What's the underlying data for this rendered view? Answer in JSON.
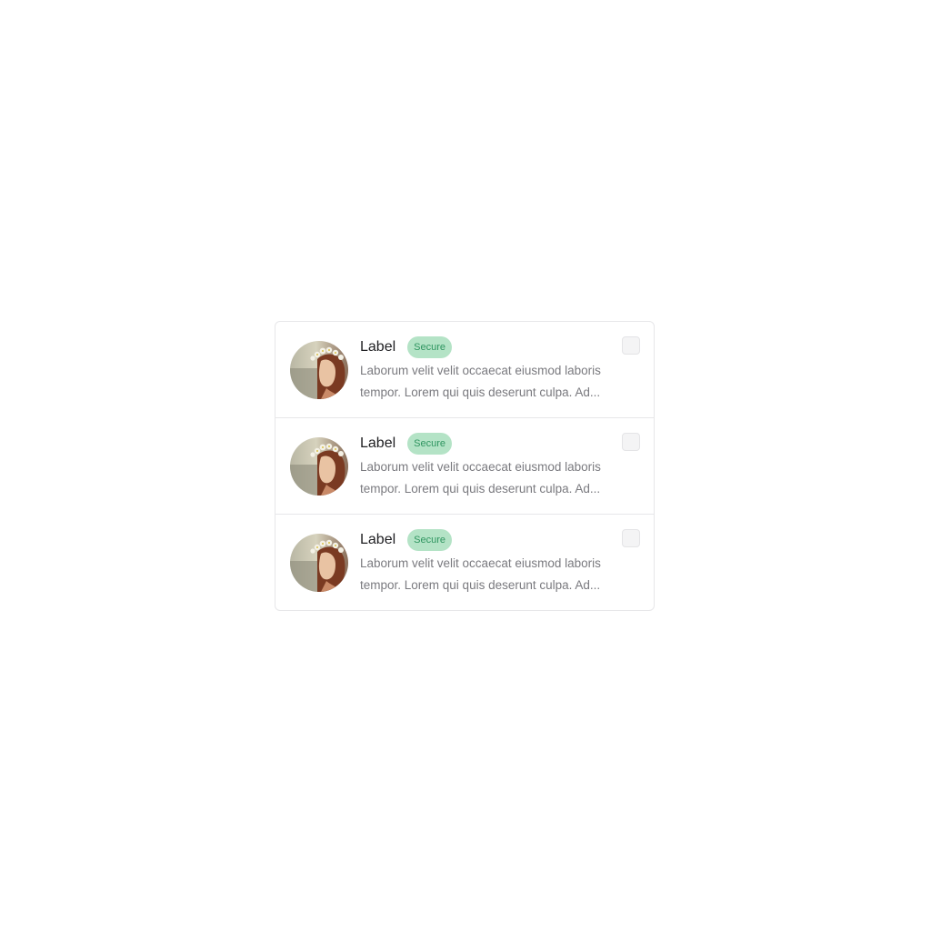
{
  "list": {
    "items": [
      {
        "label": "Label",
        "badge": "Secure",
        "description": "Laborum velit velit occaecat eiusmod laboris tempor. Lorem qui quis deserunt culpa. Ad..."
      },
      {
        "label": "Label",
        "badge": "Secure",
        "description": "Laborum velit velit occaecat eiusmod laboris tempor. Lorem qui quis deserunt culpa. Ad..."
      },
      {
        "label": "Label",
        "badge": "Secure",
        "description": "Laborum velit velit occaecat eiusmod laboris tempor. Lorem qui quis deserunt culpa. Ad..."
      }
    ]
  },
  "colors": {
    "badge_bg": "#b4e3c6",
    "badge_text": "#2f9560",
    "label_text": "#1f1f22",
    "description_text": "#7a7a7f",
    "border": "#e7e7e9"
  }
}
